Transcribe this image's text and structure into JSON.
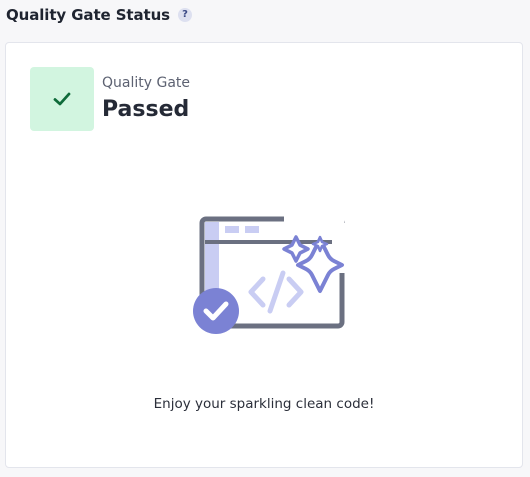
{
  "header": {
    "title": "Quality Gate Status",
    "help_glyph": "?",
    "help_icon": "question-circle-icon"
  },
  "status": {
    "label": "Quality Gate",
    "value": "Passed",
    "icon": "check-icon",
    "color": "#0f6b3a",
    "background": "#d2f5e0"
  },
  "illustration": {
    "icon": "sparkling-code-window-illustration",
    "colors": {
      "frame": "#6b7081",
      "accent": "#7b82d4",
      "light": "#c9cdf3"
    }
  },
  "message": "Enjoy your sparkling clean code!"
}
